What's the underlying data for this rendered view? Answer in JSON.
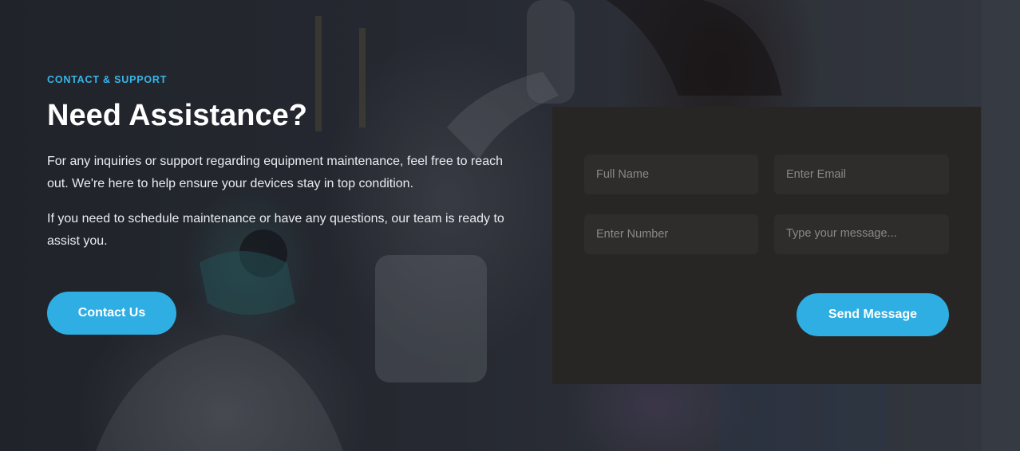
{
  "section": {
    "eyebrow": "CONTACT & SUPPORT",
    "title": "Need Assistance?",
    "paragraph_1": "For any inquiries or support regarding equipment maintenance, feel free to reach out. We're here to help ensure your devices stay in top condition.",
    "paragraph_2": "If you need to schedule maintenance or have any questions, our team is ready to assist you.",
    "contact_button": "Contact Us"
  },
  "form": {
    "full_name_placeholder": "Full Name",
    "email_placeholder": "Enter Email",
    "number_placeholder": "Enter Number",
    "message_placeholder": "Type your message...",
    "submit_label": "Send Message"
  },
  "colors": {
    "accent": "#2eaee3",
    "eyebrow": "#38b5ea",
    "panel": "#282624",
    "field": "#2f2d2b"
  }
}
